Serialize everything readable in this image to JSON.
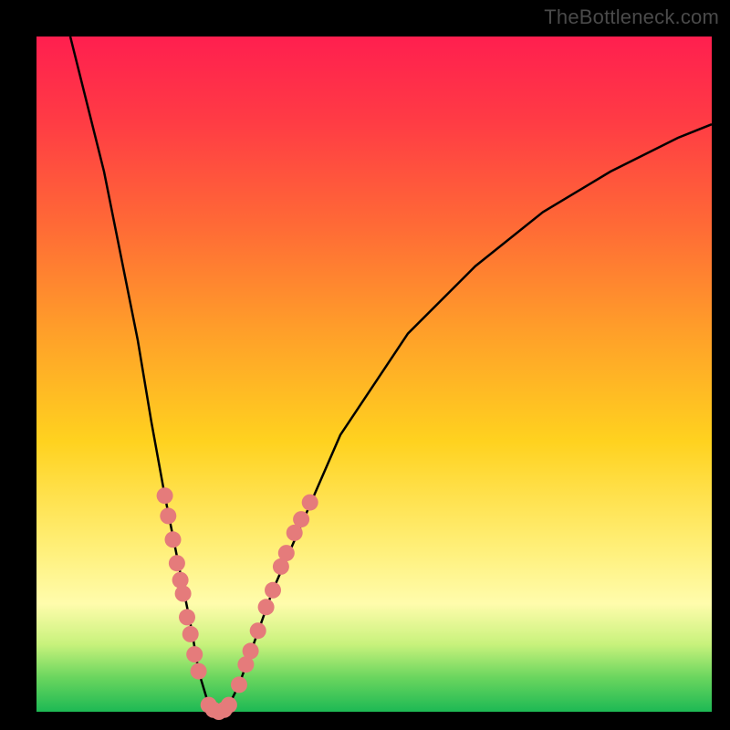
{
  "watermark": "TheBottleneck.com",
  "colors": {
    "frame": "#000000",
    "gradient_top": "#ff1f4f",
    "gradient_bottom": "#1db954",
    "curve": "#000000",
    "dots": "#e57b7b"
  },
  "chart_data": {
    "type": "line",
    "title": "",
    "xlabel": "",
    "ylabel": "",
    "xlim": [
      0,
      100
    ],
    "ylim": [
      0,
      100
    ],
    "grid": false,
    "series": [
      {
        "name": "bottleneck-curve",
        "x": [
          5,
          10,
          15,
          17,
          19,
          21,
          23,
          24,
          25.5,
          27,
          28.5,
          30,
          35,
          45,
          55,
          65,
          75,
          85,
          95,
          100
        ],
        "y": [
          100,
          80,
          55,
          43,
          32,
          22,
          12,
          6,
          1,
          0,
          1,
          4,
          18,
          41,
          56,
          66,
          74,
          80,
          85,
          87
        ]
      }
    ],
    "markers": [
      {
        "x": 19.0,
        "y": 32
      },
      {
        "x": 19.5,
        "y": 29
      },
      {
        "x": 20.2,
        "y": 25.5
      },
      {
        "x": 20.8,
        "y": 22
      },
      {
        "x": 21.3,
        "y": 19.5
      },
      {
        "x": 21.7,
        "y": 17.5
      },
      {
        "x": 22.3,
        "y": 14
      },
      {
        "x": 22.8,
        "y": 11.5
      },
      {
        "x": 23.4,
        "y": 8.5
      },
      {
        "x": 24.0,
        "y": 6
      },
      {
        "x": 25.5,
        "y": 1
      },
      {
        "x": 26.2,
        "y": 0.3
      },
      {
        "x": 27.0,
        "y": 0
      },
      {
        "x": 27.8,
        "y": 0.3
      },
      {
        "x": 28.5,
        "y": 1
      },
      {
        "x": 30.0,
        "y": 4
      },
      {
        "x": 31.0,
        "y": 7
      },
      {
        "x": 31.7,
        "y": 9
      },
      {
        "x": 32.8,
        "y": 12
      },
      {
        "x": 34.0,
        "y": 15.5
      },
      {
        "x": 35.0,
        "y": 18
      },
      {
        "x": 36.2,
        "y": 21.5
      },
      {
        "x": 37.0,
        "y": 23.5
      },
      {
        "x": 38.2,
        "y": 26.5
      },
      {
        "x": 39.2,
        "y": 28.5
      },
      {
        "x": 40.5,
        "y": 31
      }
    ]
  }
}
